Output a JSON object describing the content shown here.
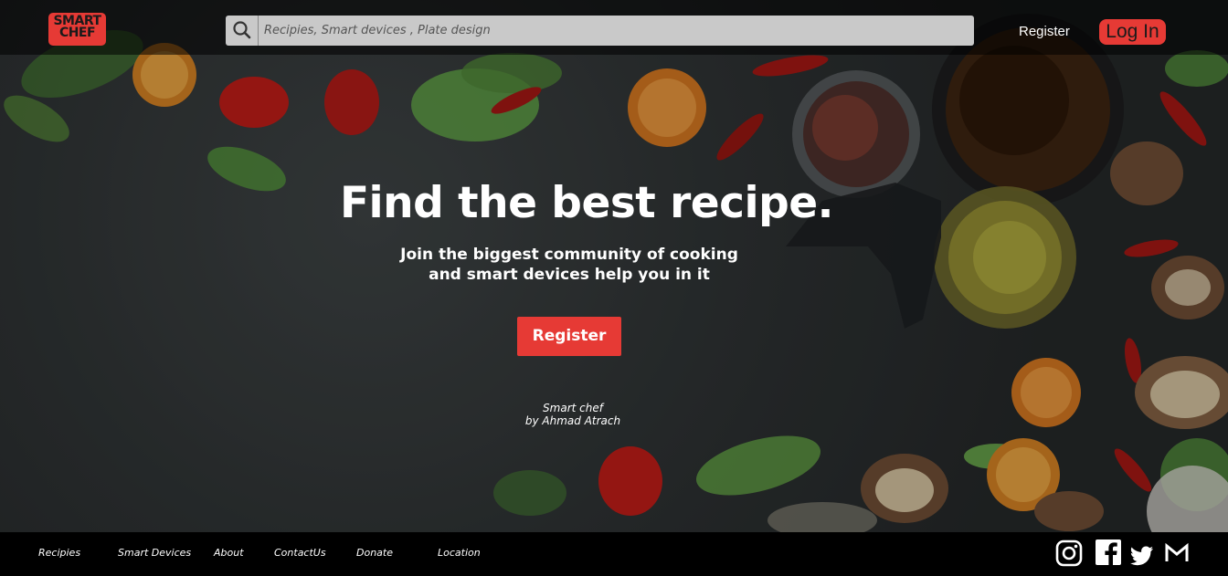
{
  "header": {
    "logo_line1": "SMART",
    "logo_line2": "CHEF",
    "search_placeholder": "Recipies, Smart devices , Plate design",
    "register_label": "Register",
    "login_label": "Log In"
  },
  "hero": {
    "title": "Find the best recipe.",
    "subtitle_line1": "Join the biggest community of cooking",
    "subtitle_line2": "and smart devices help you in it",
    "cta_label": "Register",
    "credit_line1": "Smart chef",
    "credit_line2": "by Ahmad Atrach"
  },
  "footer": {
    "links": [
      "Recipies",
      "Smart Devices",
      "About",
      "ContactUs",
      "Donate",
      "Location"
    ],
    "social_icons": [
      "instagram-icon",
      "facebook-icon",
      "twitter-icon",
      "gmail-icon"
    ]
  },
  "colors": {
    "accent": "#e63a35",
    "topbar": "#000000",
    "search_bg": "#c9c9c9",
    "footer_bg": "#000000"
  }
}
